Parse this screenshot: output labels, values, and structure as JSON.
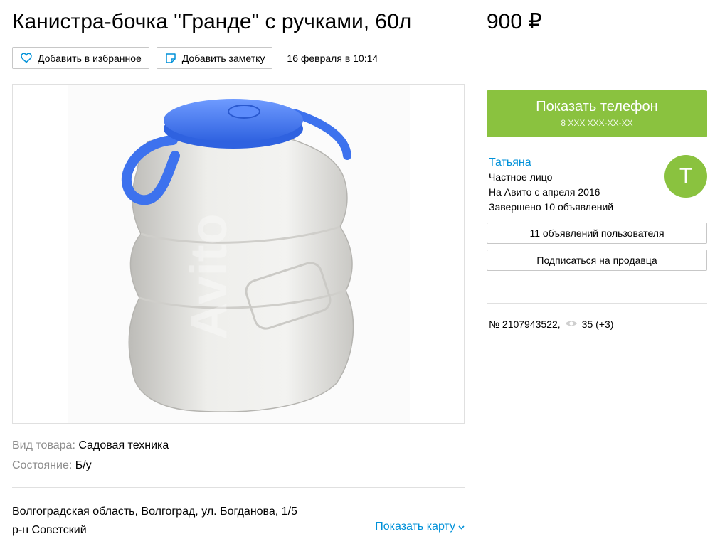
{
  "listing": {
    "title": "Канистра-бочка \"Гранде\" с ручками, 60л",
    "price": "900 ₽",
    "date": "16 февраля в 10:14",
    "favorite_label": "Добавить в избранное",
    "note_label": "Добавить заметку",
    "watermark": "Avito"
  },
  "params": {
    "type_key": "Вид товара:",
    "type_val": "Садовая техника",
    "condition_key": "Состояние:",
    "condition_val": "Б/у"
  },
  "location": {
    "address": "Волгоградская область, Волгоград, ул. Богданова, 1/5",
    "district": "р-н Советский",
    "show_map": "Показать карту"
  },
  "contact": {
    "button_label": "Показать телефон",
    "phone_mask": "8 XXX XXX-XX-XX"
  },
  "seller": {
    "name": "Татьяна",
    "type": "Частное лицо",
    "since": "На Авито с апреля 2016",
    "completed": "Завершено 10 объявлений",
    "avatar_letter": "Т",
    "ads_button": "11 объявлений пользователя",
    "subscribe_button": "Подписаться на продавца"
  },
  "meta": {
    "ad_number": "№ 2107943522,",
    "views": "35 (+3)"
  },
  "colors": {
    "accent_green": "#8ac23f",
    "link_blue": "#0091d9",
    "lid_blue": "#3d72ee"
  },
  "icons": [
    "heart-icon",
    "note-icon",
    "eye-icon",
    "chevron-down-icon"
  ]
}
